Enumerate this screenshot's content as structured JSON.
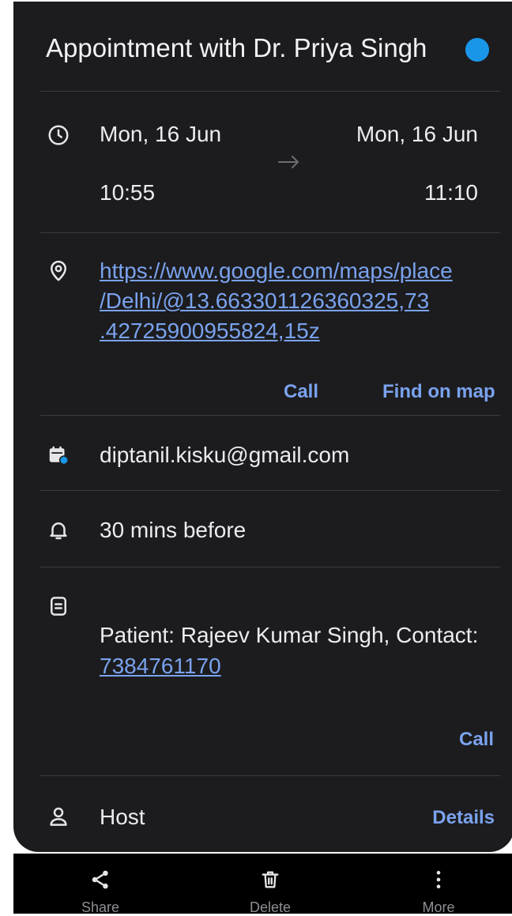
{
  "event": {
    "title": "Appointment with Dr. Priya Singh",
    "color": "#1a96e8",
    "start_date": "Mon, 16 Jun",
    "start_time": "10:55",
    "end_date": "Mon, 16 Jun",
    "end_time": "11:10"
  },
  "location": {
    "url_lines": [
      "https://www.google.com/maps/place",
      "/Delhi/@13.663301126360325,73",
      ".42725900955824,15z"
    ],
    "call_label": "Call",
    "find_label": "Find on map"
  },
  "calendar": {
    "account": "diptanil.kisku@gmail.com"
  },
  "reminder": {
    "text": "30 mins before"
  },
  "notes": {
    "text": "Patient: Rajeev Kumar Singh, Contact:",
    "phone": "7384761170",
    "call_label": "Call"
  },
  "host": {
    "label": "Host",
    "details_label": "Details"
  },
  "toolbar": {
    "share_label": "Share",
    "delete_label": "Delete",
    "more_label": "More"
  }
}
